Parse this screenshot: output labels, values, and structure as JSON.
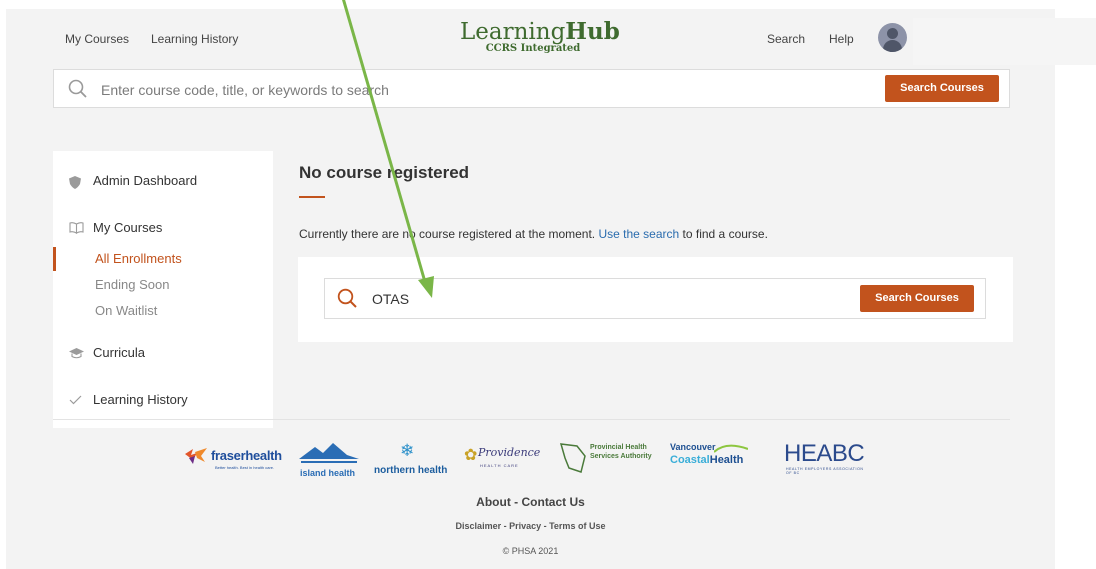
{
  "nav": {
    "my_courses": "My Courses",
    "learning_history": "Learning History",
    "search": "Search",
    "help": "Help"
  },
  "logo": {
    "main_light": "Learning",
    "main_bold": "Hub",
    "sub": "CCRS Integrated"
  },
  "top_search": {
    "placeholder": "Enter course code, title, or keywords to search",
    "button": "Search Courses"
  },
  "sidebar": {
    "admin_dashboard": "Admin Dashboard",
    "my_courses": "My Courses",
    "sub_items": [
      "All Enrollments",
      "Ending Soon",
      "On Waitlist"
    ],
    "curricula": "Curricula",
    "learning_history": "Learning History"
  },
  "main": {
    "heading": "No course registered",
    "message_before": "Currently there are no course registered at the moment. ",
    "message_link": "Use the search",
    "message_after": " to find a course.",
    "search_value": "OTAS",
    "search_button": "Search Courses"
  },
  "partners": {
    "fraser": "fraserhealth",
    "fraser_tag": "Better health. Best in health care.",
    "island": "island health",
    "northern": "northern health",
    "providence": "Providence",
    "providence_sub": "HEALTH CARE",
    "phsa_1": "Provincial Health",
    "phsa_2": "Services Authority",
    "vch_1": "Vancouver",
    "vch_2a": "Coastal",
    "vch_2b": "Health",
    "heabc": "HEABC",
    "heabc_sub": "HEALTH EMPLOYERS ASSOCIATION OF BC"
  },
  "footer": {
    "line1": "About - Contact Us",
    "line2": "Disclaimer - Privacy - Terms of Use",
    "line3": "© PHSA 2021"
  },
  "colors": {
    "accent": "#c2531d",
    "link": "#2a6cae",
    "logo_green": "#3f6b2f",
    "annotation_arrow": "#7ab648"
  }
}
